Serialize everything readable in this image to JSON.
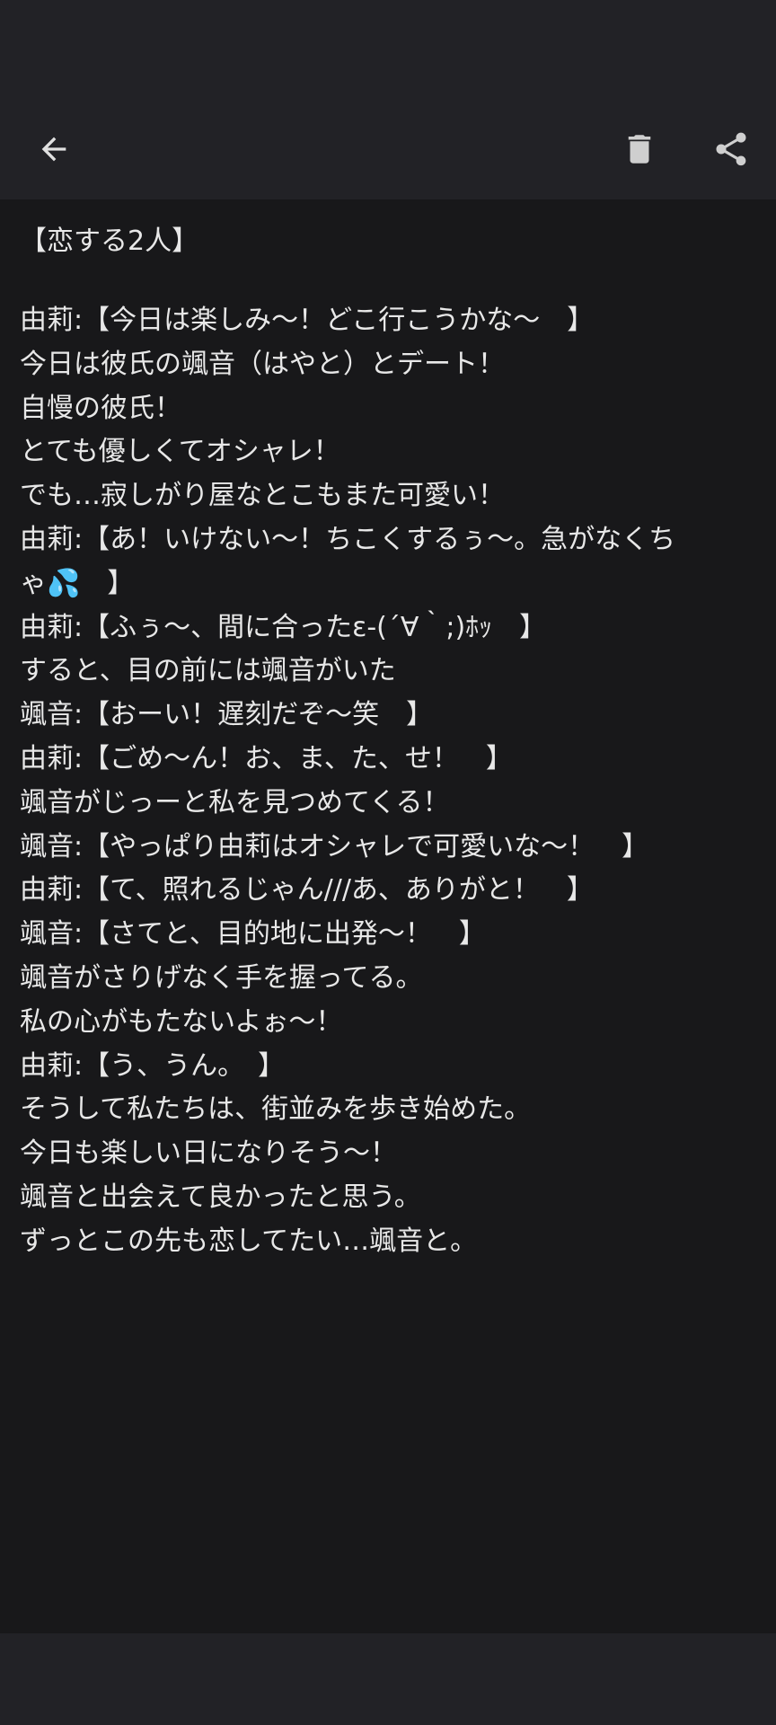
{
  "toolbar": {
    "back_icon": "arrow-left-icon",
    "delete_icon": "trash-icon",
    "share_icon": "share-icon",
    "icon_color": "#e0e0e0"
  },
  "note": {
    "title": "【恋する2人】",
    "lines": [
      "由莉:【今日は楽しみ〜！どこ行こうかな〜　】",
      "今日は彼氏の颯音（はやと）とデート！",
      "自慢の彼氏！",
      "とても優しくてオシャレ！",
      "でも…寂しがり屋なとこもまた可愛い！",
      "由莉:【あ！いけない〜！ちこくするぅ〜。急がなくち",
      "ゃ💦　】",
      "由莉:【ふぅ〜、間に合ったε-(´∀｀;)ﾎｯ　】",
      "すると、目の前には颯音がいた",
      "颯音:【おーい！遅刻だぞ〜笑　】",
      "由莉:【ごめ〜ん！お、ま、た、せ！　】",
      "颯音がじっーと私を見つめてくる！",
      "颯音:【やっぱり由莉はオシャレで可愛いな〜！　】",
      "由莉:【て、照れるじゃん///あ、ありがと！　】",
      "颯音:【さてと、目的地に出発〜！　】",
      "颯音がさりげなく手を握ってる。",
      "私の心がもたないよぉ〜！",
      "由莉:【う、うん。　】",
      "そうして私たちは、街並みを歩き始めた。",
      "今日も楽しい日になりそう〜！",
      "颯音と出会えて良かったと思う。",
      "ずっとこの先も恋してたい…颯音と。"
    ]
  }
}
